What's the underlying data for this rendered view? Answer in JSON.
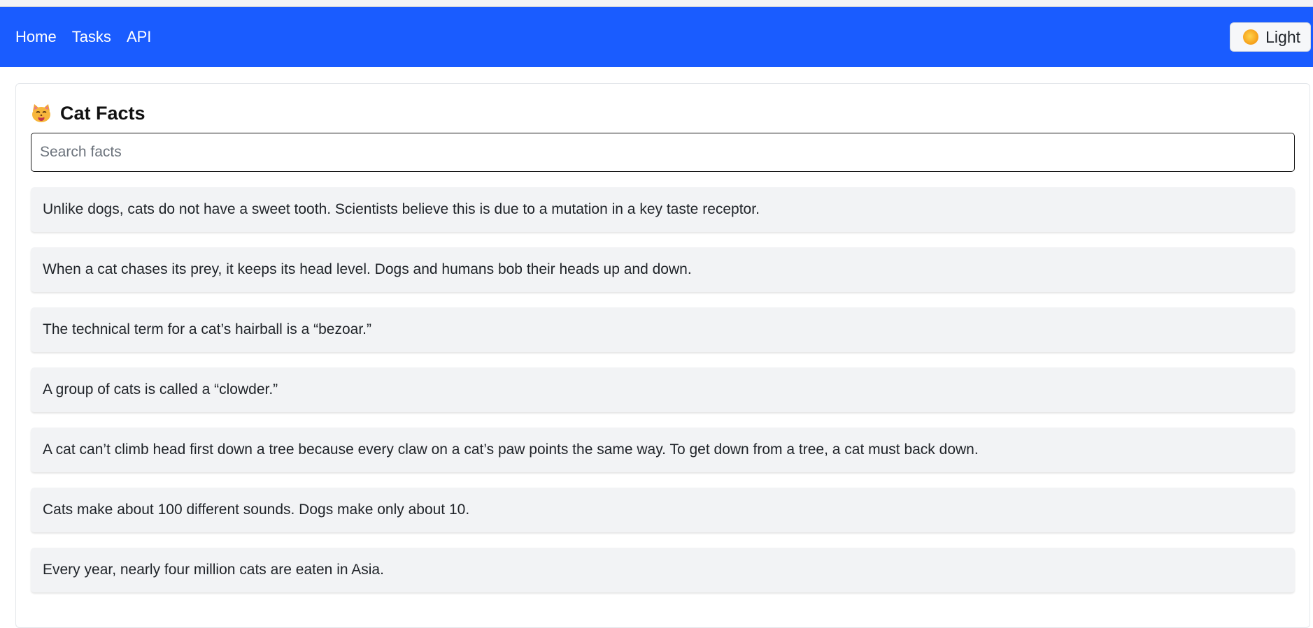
{
  "nav": {
    "links": [
      {
        "label": "Home"
      },
      {
        "label": "Tasks"
      },
      {
        "label": "API"
      }
    ],
    "theme_button": {
      "label": "Light",
      "icon": "sun-icon"
    },
    "background_color": "#1a5cff"
  },
  "card": {
    "title": "Cat Facts",
    "icon": "cat-face-icon",
    "search": {
      "placeholder": "Search facts",
      "value": ""
    }
  },
  "facts": [
    "Unlike dogs, cats do not have a sweet tooth. Scientists believe this is due to a mutation in a key taste receptor.",
    "When a cat chases its prey, it keeps its head level. Dogs and humans bob their heads up and down.",
    "The technical term for a cat’s hairball is a “bezoar.”",
    "A group of cats is called a “clowder.”",
    "A cat can’t climb head first down a tree because every claw on a cat’s paw points the same way. To get down from a tree, a cat must back down.",
    "Cats make about 100 different sounds. Dogs make only about 10.",
    "Every year, nearly four million cats are eaten in Asia."
  ]
}
